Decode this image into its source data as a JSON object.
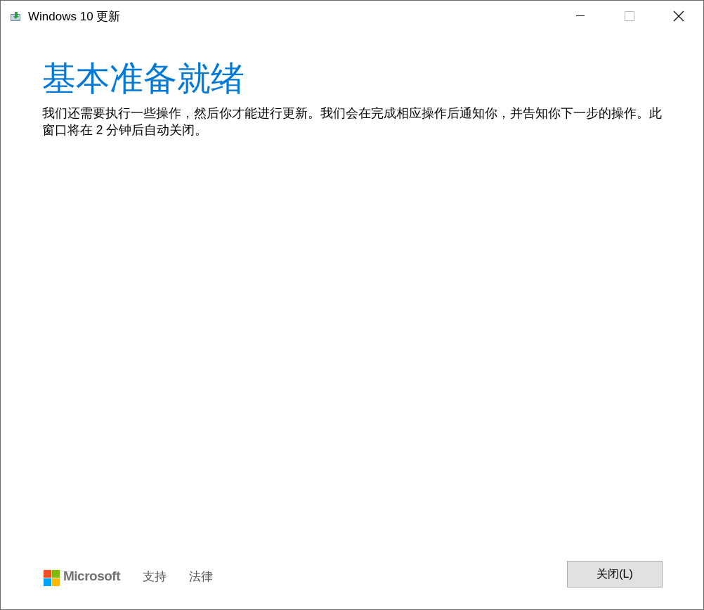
{
  "window": {
    "title": "Windows 10 更新"
  },
  "heading": "基本准备就绪",
  "message": "我们还需要执行一些操作，然后你才能进行更新。我们会在完成相应操作后通知你，并告知你下一步的操作。此窗口将在 2 分钟后自动关闭。",
  "footer": {
    "brand": "Microsoft",
    "links": [
      "支持",
      "法律"
    ]
  },
  "buttons": [
    "关闭(L)"
  ]
}
